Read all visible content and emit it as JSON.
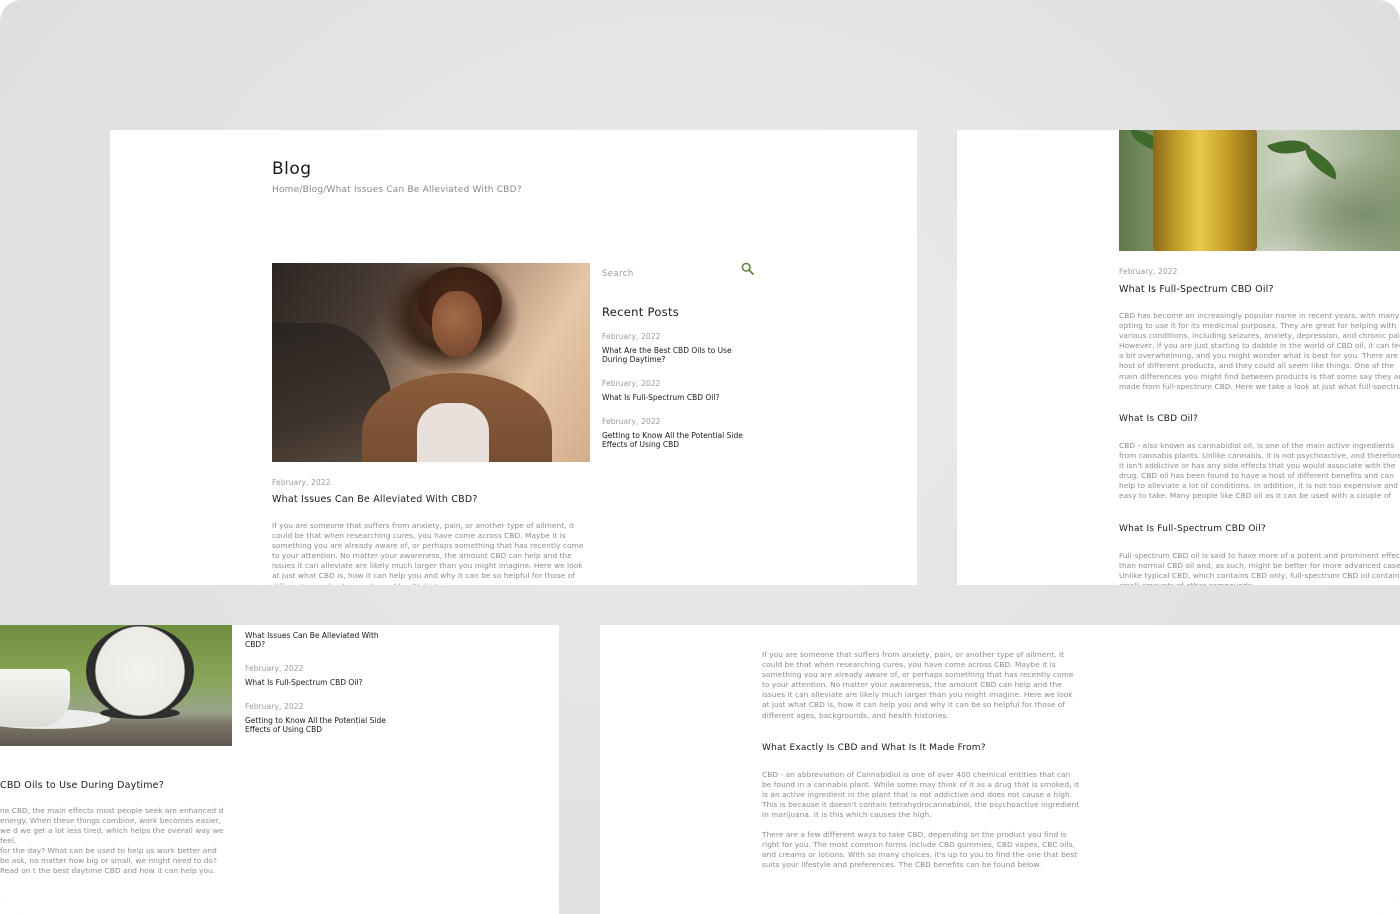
{
  "colors": {
    "accent_green": "#5e8a3a",
    "text_dark": "#1a1a1a",
    "text_muted": "#8c8c8c",
    "backdrop": "#e3e3e3"
  },
  "blog_page": {
    "title": "Blog",
    "breadcrumb": "Home/Blog/What Issues Can Be Alleviated With CBD?",
    "post": {
      "date": "February, 2022",
      "title": "What Issues Can Be Alleviated With CBD?",
      "excerpt": "If you are someone that suffers from anxiety, pain, or another type of ailment, it could be that when researching cures, you have come across CBD. Maybe it is something you are already aware of, or perhaps something that has recently come to your attention. No matter your awareness, the amount CBD can help and the issues it can alleviate are likely much larger than you might imagine. Here we look at just what CBD is, how it can help you and why it can be so helpful for those of different ages, backgrounds, and health histories."
    },
    "sidebar": {
      "search_placeholder": "Search",
      "search_icon": "search-icon",
      "recent_heading": "Recent Posts",
      "recent_posts": [
        {
          "date": "February, 2022",
          "title": "What Are the Best CBD Oils to Use During Daytime?"
        },
        {
          "date": "February, 2022",
          "title": "What Is Full-Spectrum CBD Oil?"
        },
        {
          "date": "February, 2022",
          "title": "Getting to Know All the Potential Side Effects of Using CBD"
        }
      ]
    }
  },
  "full_spectrum_page": {
    "date": "February, 2022",
    "title": "What Is Full-Spectrum CBD Oil?",
    "intro": "CBD has become an increasingly popular name in recent years, with many opting to use it for its medicinal purposes. They are great for helping with various conditions, including seizures, anxiety, depression, and chronic pain. However, if you are just starting to dabble in the world of CBD oil, it can feel a bit overwhelming, and you might wonder what is best for you. There are a host of different products, and they could all seem like things. One of the main differences you might find between products is that some say they are made from full-spectrum CBD. Here we take a look at just what full-spectrum CBD oil is and how it can help.",
    "h2": "What Is CBD Oil?",
    "p2": "CBD - also known as cannabidiol oil, is one of the main active ingredients from cannabis plants. Unlike cannabis, it is not psychoactive, and therefore it isn't addictive or has any side effects that you would associate with the drug. CBD oil has been found to have a host of different benefits and can help to alleviate a lot of conditions. In addition, it is not too expensive and is easy to take. Many people like CBD oil as it can be used with a couple of drops on the tongue and doesn't usually taste too potent.",
    "h3": "What Is Full-Spectrum CBD Oil?",
    "p3": "Full-spectrum CBD oil is said to have more of a potent and prominent effect than normal CBD oil and, as such, might be better for more advanced cases. Unlike typical CBD, which contains CBD only, full-spectrum CBD oil contains small amounts of other compounds."
  },
  "daytime_page": {
    "recent_posts": [
      {
        "date": "",
        "title": "What Issues Can Be Alleviated With CBD?"
      },
      {
        "date": "February, 2022",
        "title": "What Is Full-Spectrum CBD Oil?"
      },
      {
        "date": "February, 2022",
        "title": "Getting to Know All the Potential Side Effects of Using CBD"
      }
    ],
    "title": "CBD Oils to Use During Daytime?",
    "p1": "ne CBD, the main effects most people seek are enhanced d energy. When these things combine, work becomes easier, we d we get a lot less tired, which helps the overall way we feel.",
    "p2": "for the day? What can be used to help us work better and be ask, no matter how big or small, we might need to do? Read on t the best daytime CBD and how it can help you."
  },
  "article_page": {
    "p1": "If you are someone that suffers from anxiety, pain, or another type of ailment, it could be that when researching cures, you have come across CBD. Maybe it is something you are already aware of, or perhaps something that has recently come to your attention. No matter your awareness, the amount CBD can help and the issues it can alleviate are likely much larger than you might imagine. Here we look at just what CBD is, how it can help you and why it can be so helpful for those of different ages, backgrounds, and health histories.",
    "h2": "What Exactly Is CBD and What Is It Made From?",
    "p2": "CBD - an abbreviation of Cannabidiol is one of over 400 chemical entities that can be found in a cannabis plant. While some may think of it as a drug that is smoked, it is an active ingredient in the plant that is not addictive and does not cause a high. This is because it doesn't contain tetrahydrocannabinol, the psychoactive ingredient in marijuana. It is this which causes the high.",
    "p3": "There are a few different ways to take CBD, depending on the product you find is right for you. The most common forms include CBD gummies, CBD vapes, CBC oils, and creams or lotions. With so many choices, it's up to you to find the one that best suits your lifestyle and preferences. The CBD benefits can be found below."
  }
}
